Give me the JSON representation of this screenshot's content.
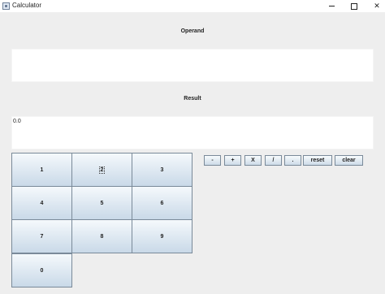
{
  "window": {
    "title": "Calculator"
  },
  "operand": {
    "label": "Operand",
    "value": ""
  },
  "result": {
    "label": "Result",
    "value": "0.0"
  },
  "keypad": {
    "k1": "1",
    "k2": "2",
    "k3": "3",
    "k4": "4",
    "k5": "5",
    "k6": "6",
    "k7": "7",
    "k8": "8",
    "k9": "9",
    "k0": "0"
  },
  "operators": {
    "minus": "-",
    "plus": "+",
    "multiply": "X",
    "divide": "/",
    "decimal": ".",
    "reset": "reset",
    "clear": "clear"
  },
  "icons": {
    "app": "calculator-app-icon",
    "minimize": "minimize-icon",
    "maximize": "maximize-icon",
    "close": "close-icon"
  },
  "colors": {
    "window_bg": "#eeeeee",
    "field_bg": "#ffffff",
    "button_top": "#f5f9fc",
    "button_bottom": "#c9d9e8",
    "button_border": "#7a8a99"
  }
}
